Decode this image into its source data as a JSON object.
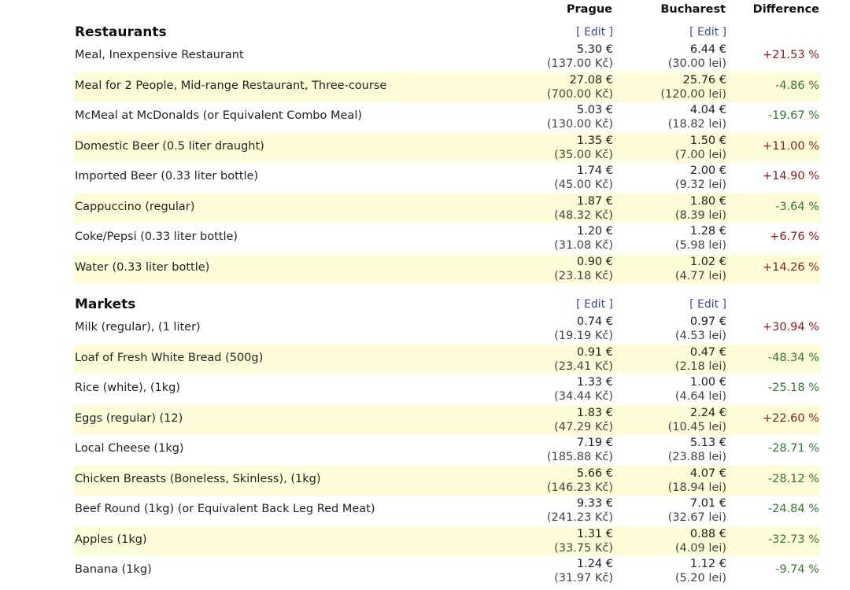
{
  "columns": {
    "city1": "Prague",
    "city2": "Bucharest",
    "difference": "Difference"
  },
  "edit_label": "[ Edit ]",
  "colors": {
    "row_highlight": "#fffdd9",
    "positive": "#8b1a1a",
    "negative": "#2e7a2e",
    "link": "#3b4aa6"
  },
  "sections": [
    {
      "title": "Restaurants",
      "rows": [
        {
          "label": "Meal, Inexpensive Restaurant",
          "city1_eur": "5.30 €",
          "city1_local": "(137.00 Kč)",
          "city2_eur": "6.44 €",
          "city2_local": "(30.00 lei)",
          "diff": "+21.53 %"
        },
        {
          "label": "Meal for 2 People, Mid-range Restaurant, Three-course",
          "city1_eur": "27.08 €",
          "city1_local": "(700.00 Kč)",
          "city2_eur": "25.76 €",
          "city2_local": "(120.00 lei)",
          "diff": "-4.86 %"
        },
        {
          "label": "McMeal at McDonalds (or Equivalent Combo Meal)",
          "city1_eur": "5.03 €",
          "city1_local": "(130.00 Kč)",
          "city2_eur": "4.04 €",
          "city2_local": "(18.82 lei)",
          "diff": "-19.67 %"
        },
        {
          "label": "Domestic Beer (0.5 liter draught)",
          "city1_eur": "1.35 €",
          "city1_local": "(35.00 Kč)",
          "city2_eur": "1.50 €",
          "city2_local": "(7.00 lei)",
          "diff": "+11.00 %"
        },
        {
          "label": "Imported Beer (0.33 liter bottle)",
          "city1_eur": "1.74 €",
          "city1_local": "(45.00 Kč)",
          "city2_eur": "2.00 €",
          "city2_local": "(9.32 lei)",
          "diff": "+14.90 %"
        },
        {
          "label": "Cappuccino (regular)",
          "city1_eur": "1.87 €",
          "city1_local": "(48.32 Kč)",
          "city2_eur": "1.80 €",
          "city2_local": "(8.39 lei)",
          "diff": "-3.64 %"
        },
        {
          "label": "Coke/Pepsi (0.33 liter bottle)",
          "city1_eur": "1.20 €",
          "city1_local": "(31.08 Kč)",
          "city2_eur": "1.28 €",
          "city2_local": "(5.98 lei)",
          "diff": "+6.76 %"
        },
        {
          "label": "Water (0.33 liter bottle)",
          "city1_eur": "0.90 €",
          "city1_local": "(23.18 Kč)",
          "city2_eur": "1.02 €",
          "city2_local": "(4.77 lei)",
          "diff": "+14.26 %"
        }
      ]
    },
    {
      "title": "Markets",
      "rows": [
        {
          "label": "Milk (regular), (1 liter)",
          "city1_eur": "0.74 €",
          "city1_local": "(19.19 Kč)",
          "city2_eur": "0.97 €",
          "city2_local": "(4.53 lei)",
          "diff": "+30.94 %"
        },
        {
          "label": "Loaf of Fresh White Bread (500g)",
          "city1_eur": "0.91 €",
          "city1_local": "(23.41 Kč)",
          "city2_eur": "0.47 €",
          "city2_local": "(2.18 lei)",
          "diff": "-48.34 %"
        },
        {
          "label": "Rice (white), (1kg)",
          "city1_eur": "1.33 €",
          "city1_local": "(34.44 Kč)",
          "city2_eur": "1.00 €",
          "city2_local": "(4.64 lei)",
          "diff": "-25.18 %"
        },
        {
          "label": "Eggs (regular) (12)",
          "city1_eur": "1.83 €",
          "city1_local": "(47.29 Kč)",
          "city2_eur": "2.24 €",
          "city2_local": "(10.45 lei)",
          "diff": "+22.60 %"
        },
        {
          "label": "Local Cheese (1kg)",
          "city1_eur": "7.19 €",
          "city1_local": "(185.88 Kč)",
          "city2_eur": "5.13 €",
          "city2_local": "(23.88 lei)",
          "diff": "-28.71 %"
        },
        {
          "label": "Chicken Breasts (Boneless, Skinless), (1kg)",
          "city1_eur": "5.66 €",
          "city1_local": "(146.23 Kč)",
          "city2_eur": "4.07 €",
          "city2_local": "(18.94 lei)",
          "diff": "-28.12 %"
        },
        {
          "label": "Beef Round (1kg) (or Equivalent Back Leg Red Meat)",
          "city1_eur": "9.33 €",
          "city1_local": "(241.23 Kč)",
          "city2_eur": "7.01 €",
          "city2_local": "(32.67 lei)",
          "diff": "-24.84 %"
        },
        {
          "label": "Apples (1kg)",
          "city1_eur": "1.31 €",
          "city1_local": "(33.75 Kč)",
          "city2_eur": "0.88 €",
          "city2_local": "(4.09 lei)",
          "diff": "-32.73 %"
        },
        {
          "label": "Banana (1kg)",
          "city1_eur": "1.24 €",
          "city1_local": "(31.97 Kč)",
          "city2_eur": "1.12 €",
          "city2_local": "(5.20 lei)",
          "diff": "-9.74 %"
        }
      ]
    }
  ]
}
